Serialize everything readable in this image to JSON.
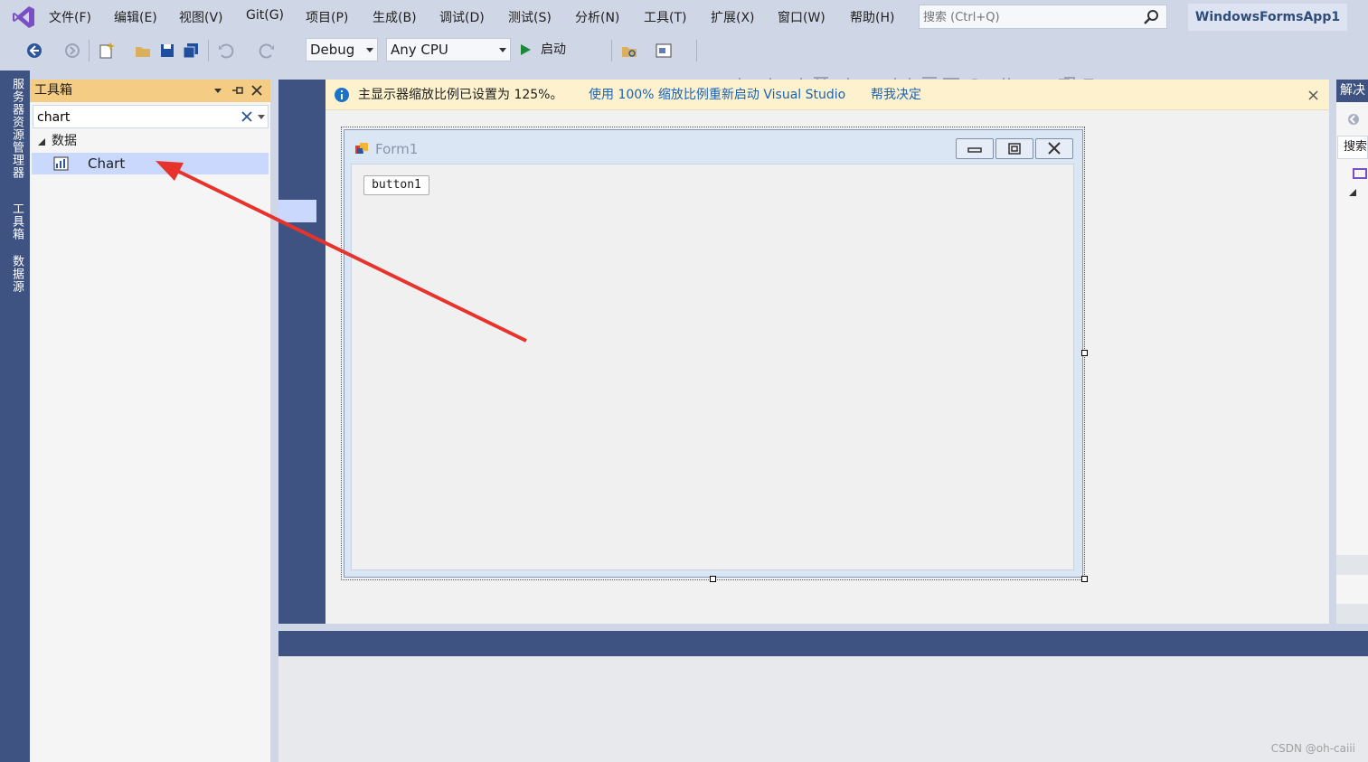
{
  "menu": {
    "items": [
      "文件(F)",
      "编辑(E)",
      "视图(V)",
      "Git(G)",
      "项目(P)",
      "生成(B)",
      "调试(D)",
      "测试(S)",
      "分析(N)",
      "工具(T)",
      "扩展(X)",
      "窗口(W)",
      "帮助(H)"
    ]
  },
  "search": {
    "placeholder": "搜索 (Ctrl+Q)"
  },
  "project_name": "WindowsFormsApp1",
  "toolbar": {
    "config": "Debug",
    "platform": "Any CPU",
    "start_label": "启动"
  },
  "left_rail": {
    "tabs": [
      "服务器资源管理器",
      "工具箱",
      "数据源"
    ]
  },
  "toolbox": {
    "title": "工具箱",
    "search_value": "chart",
    "group": "数据",
    "items": [
      "Chart"
    ]
  },
  "infobar": {
    "message": "主显示器缩放比例已设置为 125%。",
    "link1": "使用 100% 缩放比例重新启动 Visual Studio",
    "link2": "帮我决定"
  },
  "form": {
    "title": "Form1",
    "button_text": "button1"
  },
  "right_panel": {
    "title": "解决",
    "search_label": "搜索"
  },
  "watermark": "CSDN @oh-caiii",
  "colors": {
    "accent": "#3f5382",
    "toolbox_header": "#f5cc84",
    "selection": "#c9d8fc",
    "infobar": "#fdf2cd",
    "arrow": "#e8322c"
  },
  "icons": [
    "vs-logo",
    "search-icon",
    "back-icon",
    "forward-icon",
    "new-project-icon",
    "open-icon",
    "save-icon",
    "save-all-icon",
    "undo-icon",
    "redo-icon",
    "play-icon",
    "info-icon",
    "close-icon",
    "pin-icon",
    "chart-icon",
    "minimize-icon",
    "maximize-icon",
    "form-icon"
  ]
}
